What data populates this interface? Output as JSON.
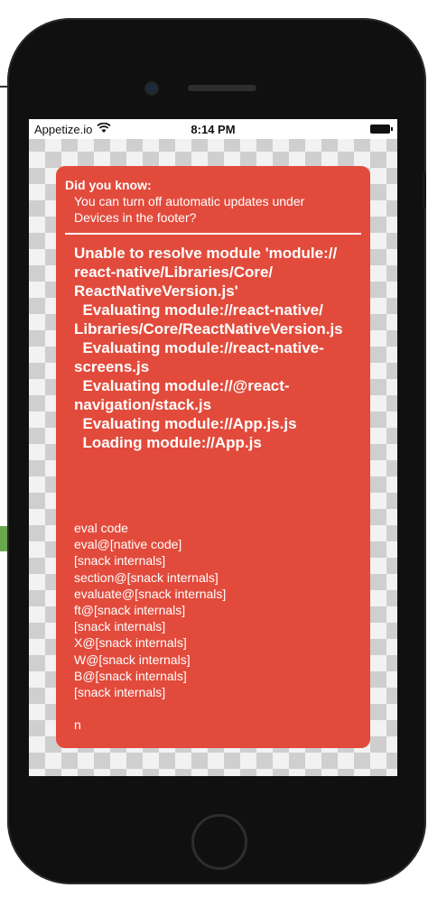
{
  "status_bar": {
    "carrier": "Appetize.io",
    "wifi_icon": "wifi-icon",
    "time": "8:14 PM",
    "battery_icon": "battery-icon"
  },
  "tip": {
    "title": "Did you know:",
    "text_line1": "You can turn off automatic updates under",
    "text_line2": "Devices in the footer?"
  },
  "error": {
    "lines": [
      "Unable to resolve module 'module://",
      "react-native/Libraries/Core/",
      "ReactNativeVersion.js'",
      "  Evaluating module://react-native/",
      "Libraries/Core/ReactNativeVersion.js",
      "  Evaluating module://react-native-",
      "screens.js",
      "  Evaluating module://@react-",
      "navigation/stack.js",
      "  Evaluating module://App.js.js",
      "  Loading module://App.js"
    ]
  },
  "stack": {
    "lines": [
      "eval code",
      "eval@[native code]",
      "[snack internals]",
      "section@[snack internals]",
      "evaluate@[snack internals]",
      "ft@[snack internals]",
      "[snack internals]",
      "X@[snack internals]",
      "W@[snack internals]",
      "B@[snack internals]",
      "[snack internals]",
      "",
      "n"
    ]
  },
  "colors": {
    "error_background": "#e24b3c",
    "text": "#ffffff"
  }
}
